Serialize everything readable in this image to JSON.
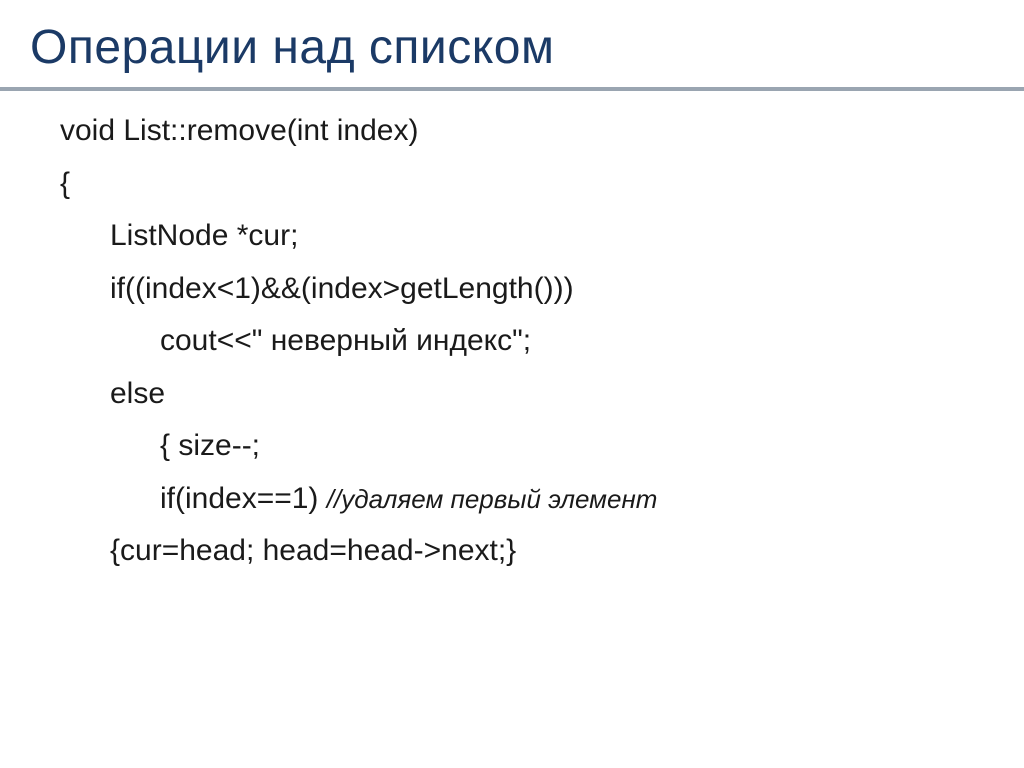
{
  "slide": {
    "title": "Операции над списком",
    "code": {
      "line1": "void List::remove(int index)",
      "line2": "{",
      "line3": "ListNode *cur;",
      "line4": "if((index<1)&&(index>getLength()))",
      "line5": "cout<<\" неверный индекс\";",
      "line6": "else",
      "line7": "{ size--;",
      "line8a": "if(index==1) ",
      "line8b": "//удаляем первый элемент",
      "line9": "{cur=head; head=head->next;}"
    }
  }
}
